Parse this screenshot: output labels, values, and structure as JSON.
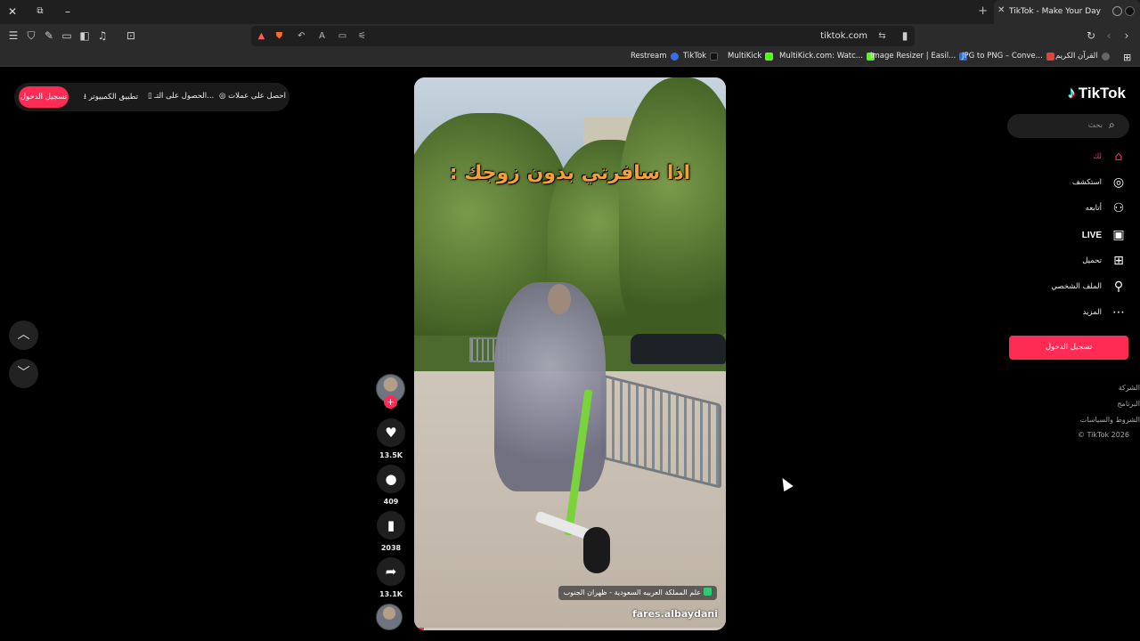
{
  "browser": {
    "tab_title": "TikTok - Make Your Day",
    "new_tab_label": "+",
    "close_label": "✕",
    "url": "tiktok.com",
    "bookmarks": [
      {
        "label": "Restream",
        "color": "#3b6cf0"
      },
      {
        "label": "TikTok",
        "color": "#111111"
      },
      {
        "label": "MultiKick",
        "color": "#53fc18"
      },
      {
        "label": "MultiKick.com: Watc...",
        "color": "#53fc18"
      },
      {
        "label": "Image Resizer | Easil...",
        "color": "#2d6cdf"
      },
      {
        "label": "JPG to PNG – Conve...",
        "color": "#e0443a"
      },
      {
        "label": "القرآن الكريم",
        "color": "#666666"
      }
    ]
  },
  "topbar": {
    "login_label": "تسجيل الدخول",
    "desktop_app_label": "تطبيق الكمبيوتر",
    "get_app_label": "الحصول على التـ...",
    "coins_label": "احصل على عملات"
  },
  "video": {
    "caption": "اذا سافرتي بدون زوجك :",
    "location": "علم المملكة العربيه السعودية - ظهران الجنوب",
    "username": "fares.albaydani",
    "progress": 0.03
  },
  "actions": {
    "likes": "13.5K",
    "comments": "409",
    "saves": "2038",
    "shares": "13.1K",
    "follow_label": "+"
  },
  "sidebar": {
    "brand": "TikTok",
    "search_placeholder": "بحث",
    "items": [
      {
        "label": "لك",
        "icon": "home-icon",
        "active": true
      },
      {
        "label": "استكشف",
        "icon": "compass-icon"
      },
      {
        "label": "أتابعه",
        "icon": "user-plus-icon"
      },
      {
        "label": "LIVE",
        "icon": "live-tv-icon"
      },
      {
        "label": "تحميل",
        "icon": "upload-plus-icon"
      },
      {
        "label": "الملف الشخصي",
        "icon": "profile-icon"
      },
      {
        "label": "المزيد",
        "icon": "more-icon"
      }
    ],
    "login_label": "تسجيل الدخول",
    "footer": [
      "الشركة",
      "البرنامج",
      "الشروط والسياسات",
      "© TikTok 2026"
    ]
  },
  "colors": {
    "accent": "#fe2c55",
    "background": "#000000"
  }
}
